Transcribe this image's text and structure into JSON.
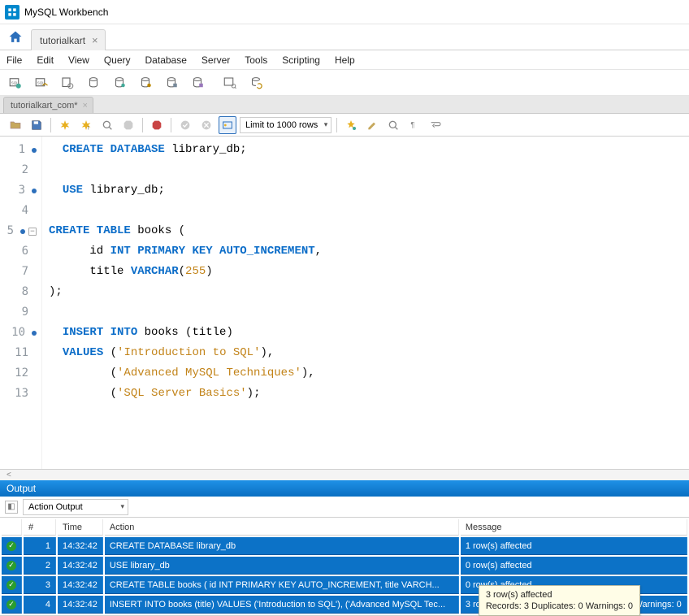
{
  "app_title": "MySQL Workbench",
  "conn_tab": {
    "label": "tutorialkart",
    "close": "×"
  },
  "menu": [
    "File",
    "Edit",
    "View",
    "Query",
    "Database",
    "Server",
    "Tools",
    "Scripting",
    "Help"
  ],
  "inner_tab": {
    "label": "tutorialkart_com*",
    "close": "×"
  },
  "limit_dropdown": "Limit to 1000 rows",
  "code_lines": [
    {
      "n": 1,
      "dot": true,
      "tokens": [
        [
          "  ",
          ""
        ],
        [
          "CREATE DATABASE",
          "kw"
        ],
        [
          " library_db",
          ""
        ],
        [
          ";",
          "punct"
        ]
      ]
    },
    {
      "n": 2,
      "tokens": []
    },
    {
      "n": 3,
      "dot": true,
      "tokens": [
        [
          "  ",
          ""
        ],
        [
          "USE",
          "kw"
        ],
        [
          " library_db",
          ""
        ],
        [
          ";",
          "punct"
        ]
      ]
    },
    {
      "n": 4,
      "tokens": []
    },
    {
      "n": 5,
      "dot": true,
      "collapse": true,
      "tokens": [
        [
          "CREATE TABLE",
          "kw"
        ],
        [
          " books ",
          ""
        ],
        [
          "(",
          "punct"
        ]
      ]
    },
    {
      "n": 6,
      "tokens": [
        [
          "      id ",
          ""
        ],
        [
          "INT PRIMARY KEY AUTO_INCREMENT",
          "kw"
        ],
        [
          ",",
          "punct"
        ]
      ]
    },
    {
      "n": 7,
      "tokens": [
        [
          "      title ",
          ""
        ],
        [
          "VARCHAR",
          "kw"
        ],
        [
          "(",
          "punct"
        ],
        [
          "255",
          "num"
        ],
        [
          ")",
          "punct"
        ]
      ]
    },
    {
      "n": 8,
      "tokens": [
        [
          ");",
          "punct"
        ]
      ]
    },
    {
      "n": 9,
      "tokens": []
    },
    {
      "n": 10,
      "dot": true,
      "tokens": [
        [
          "  ",
          ""
        ],
        [
          "INSERT INTO",
          "kw"
        ],
        [
          " books ",
          ""
        ],
        [
          "(",
          "punct"
        ],
        [
          "title",
          ""
        ],
        [
          ")",
          "punct"
        ]
      ]
    },
    {
      "n": 11,
      "tokens": [
        [
          "  ",
          ""
        ],
        [
          "VALUES",
          "kw"
        ],
        [
          " ",
          ""
        ],
        [
          "(",
          "punct"
        ],
        [
          "'Introduction to SQL'",
          "str"
        ],
        [
          "),",
          "punct"
        ]
      ]
    },
    {
      "n": 12,
      "tokens": [
        [
          "         ",
          ""
        ],
        [
          "(",
          "punct"
        ],
        [
          "'Advanced MySQL Techniques'",
          "str"
        ],
        [
          "),",
          "punct"
        ]
      ]
    },
    {
      "n": 13,
      "tokens": [
        [
          "         ",
          ""
        ],
        [
          "(",
          "punct"
        ],
        [
          "'SQL Server Basics'",
          "str"
        ],
        [
          ");",
          "punct"
        ]
      ]
    }
  ],
  "scroll_hint": "<",
  "output": {
    "header": "Output",
    "dropdown": "Action Output",
    "columns": {
      "idx": "#",
      "time": "Time",
      "action": "Action",
      "message": "Message"
    },
    "rows": [
      {
        "idx": "1",
        "time": "14:32:42",
        "action": "CREATE DATABASE library_db",
        "message": "1 row(s) affected"
      },
      {
        "idx": "2",
        "time": "14:32:42",
        "action": "USE library_db",
        "message": "0 row(s) affected"
      },
      {
        "idx": "3",
        "time": "14:32:42",
        "action": "CREATE TABLE books (     id INT PRIMARY KEY AUTO_INCREMENT,     title VARCH...",
        "message": "0 row(s) affected"
      },
      {
        "idx": "4",
        "time": "14:32:42",
        "action": "INSERT INTO books (title) VALUES ('Introduction to SQL'),         ('Advanced MySQL Tec...",
        "message": "3 row(s) affected Records: 3 Duplicates: 0 Warnings: 0"
      }
    ]
  },
  "tooltip": {
    "line1": "3 row(s) affected",
    "line2": "Records: 3  Duplicates: 0  Warnings: 0"
  }
}
